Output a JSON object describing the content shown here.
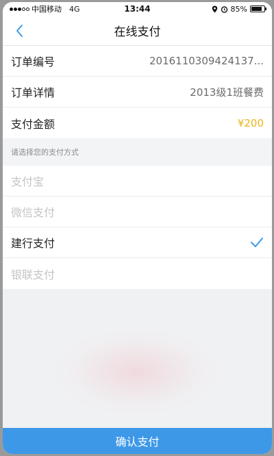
{
  "status_bar": {
    "carrier": "中国移动",
    "network": "4G",
    "time": "13:44",
    "battery": "85%",
    "battery_level": 0.85
  },
  "nav": {
    "title": "在线支付"
  },
  "order": {
    "number_label": "订单编号",
    "number_value": "2016110309424137...",
    "details_label": "订单详情",
    "details_value": "2013级1班餐费",
    "amount_label": "支付金额",
    "amount_value": "¥200"
  },
  "payment": {
    "header": "请选择您的支付方式",
    "methods": [
      {
        "label": "支付宝",
        "selected": false
      },
      {
        "label": "微信支付",
        "selected": false
      },
      {
        "label": "建行支付",
        "selected": true
      },
      {
        "label": "银联支付",
        "selected": false
      }
    ]
  },
  "confirm_button": "确认支付",
  "colors": {
    "accent": "#3e98e8",
    "amount": "#e9b319",
    "check": "#3e98e8"
  }
}
